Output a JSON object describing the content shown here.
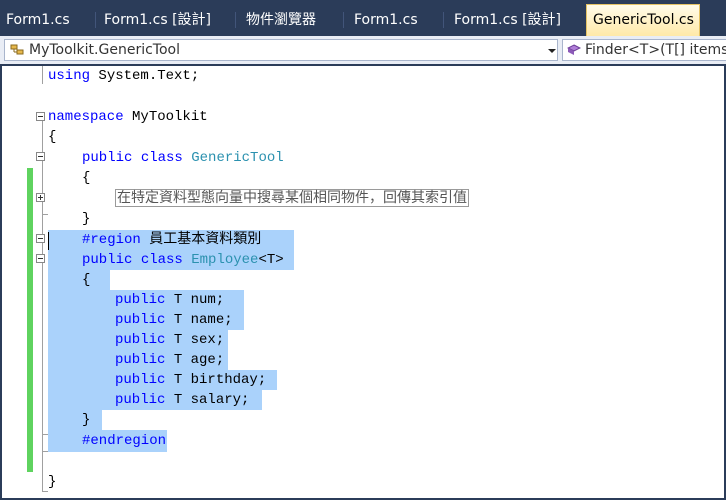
{
  "tabs": [
    {
      "label": "Form1.cs"
    },
    {
      "label": "Form1.cs [設計]"
    },
    {
      "label": "物件瀏覽器"
    },
    {
      "label": "Form1.cs"
    },
    {
      "label": "Form1.cs [設計]"
    },
    {
      "label": "GenericTool.cs",
      "active": true
    }
  ],
  "nav": {
    "type_selector": "MyToolkit.GenericTool",
    "member_selector": "Finder<T>(T[] items"
  },
  "code": {
    "using_kw": "using",
    "using_ns": " System.Text;",
    "namespace_kw": "namespace",
    "namespace_name": " MyToolkit",
    "open_brace": "{",
    "close_brace": "}",
    "public_kw": "public",
    "class_kw": "class",
    "class_name": "GenericTool",
    "collapsed_comment": "在特定資料型態向量中搜尋某個相同物件，回傳其索引值",
    "region_kw": "#region",
    "region_name": " 員工基本資料類別",
    "employee_name": "Employee",
    "generic_param": "<T>",
    "fields": [
      " T num;",
      " T name;",
      " T sex;",
      " T age;",
      " T birthday;",
      " T salary;"
    ],
    "endregion_kw": "#endregion"
  },
  "colors": {
    "keyword": "#0000ff",
    "type_name": "#2b91af",
    "selection": "#aad2fb",
    "change_bar": "#5fd35f",
    "tab_strip": "#2b3c59"
  }
}
